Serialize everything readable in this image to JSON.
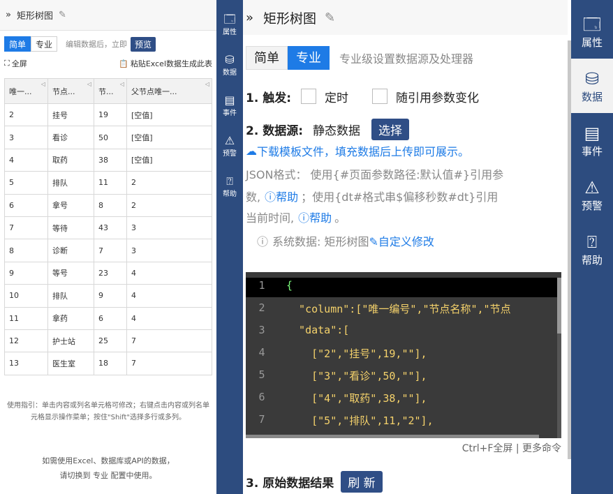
{
  "left_panel": {
    "title": "矩形树图",
    "tabs": [
      "简单",
      "专业"
    ],
    "hint": "编辑数据后，立即",
    "preview_label": "预览",
    "fullscreen_label": "全屏",
    "paste_label": "粘贴Excel数据生成此表",
    "columns": [
      "唯一...",
      "节点...",
      "节...",
      "父节点唯一..."
    ],
    "rows": [
      [
        "2",
        "挂号",
        "19",
        "[空值]"
      ],
      [
        "3",
        "看诊",
        "50",
        "[空值]"
      ],
      [
        "4",
        "取药",
        "38",
        "[空值]"
      ],
      [
        "5",
        "排队",
        "11",
        "2"
      ],
      [
        "6",
        "拿号",
        "8",
        "2"
      ],
      [
        "7",
        "等待",
        "43",
        "3"
      ],
      [
        "8",
        "诊断",
        "7",
        "3"
      ],
      [
        "9",
        "等号",
        "23",
        "4"
      ],
      [
        "10",
        "排队",
        "9",
        "4"
      ],
      [
        "11",
        "拿药",
        "6",
        "4"
      ],
      [
        "12",
        "护士站",
        "25",
        "7"
      ],
      [
        "13",
        "医生室",
        "18",
        "7"
      ]
    ],
    "guide": "使用指引：单击内容或列名单元格可修改；右键点击内容或列名单元格显示操作菜单；按住\"Shift\"选择多行或多列。",
    "switch_line1": "如需使用Excel、数据库或API的数据，",
    "switch_line2": "请切换到 专业 配置中使用。"
  },
  "nav_left": [
    {
      "icon": "properties-icon",
      "label": "属性"
    },
    {
      "icon": "database-icon",
      "label": "数据"
    },
    {
      "icon": "event-icon",
      "label": "事件"
    },
    {
      "icon": "alarm-icon",
      "label": "预警"
    },
    {
      "icon": "help-icon",
      "label": "帮助"
    }
  ],
  "nav_right": [
    {
      "icon": "properties-icon",
      "label": "属性"
    },
    {
      "icon": "database-icon",
      "label": "数据"
    },
    {
      "icon": "event-icon",
      "label": "事件"
    },
    {
      "icon": "alarm-icon",
      "label": "预警"
    },
    {
      "icon": "help-icon",
      "label": "帮助"
    }
  ],
  "main": {
    "title": "矩形树图",
    "tabs": [
      "简单",
      "专业"
    ],
    "tab_desc": "专业级设置数据源及处理器",
    "trigger_label": "1. 触发:",
    "trigger_timer": "定时",
    "trigger_param": "随引用参数变化",
    "source_label": "2. 数据源:",
    "source_value": "静态数据",
    "select_label": "选择",
    "download_text": "下载模板文件，填充数据后上传即可展示。",
    "json_line1": "JSON格式： 使用{#页面参数路径:默认值#}引用参",
    "json_line2a": "数,",
    "help1": "帮助",
    "json_line2b": "；使用{dt#格式串$偏移秒数#dt}引用",
    "json_line3a": "当前时间,",
    "help2": "帮助",
    "json_line3b": "。",
    "system_prefix": "系统数据: 矩形树图",
    "custom_edit": "自定义修改",
    "editor_lines": [
      "{",
      "  \"column\":[\"唯一编号\",\"节点名称\",\"节点",
      "  \"data\":[",
      "    [\"2\",\"挂号\",19,\"\"],",
      "    [\"3\",\"看诊\",50,\"\"],",
      "    [\"4\",\"取药\",38,\"\"],",
      "    [\"5\",\"排队\",11,\"2\"],"
    ],
    "editor_hint": "Ctrl+F全屏 | 更多命令",
    "result_label": "3. 原始数据结果",
    "refresh_label": "刷 新"
  }
}
